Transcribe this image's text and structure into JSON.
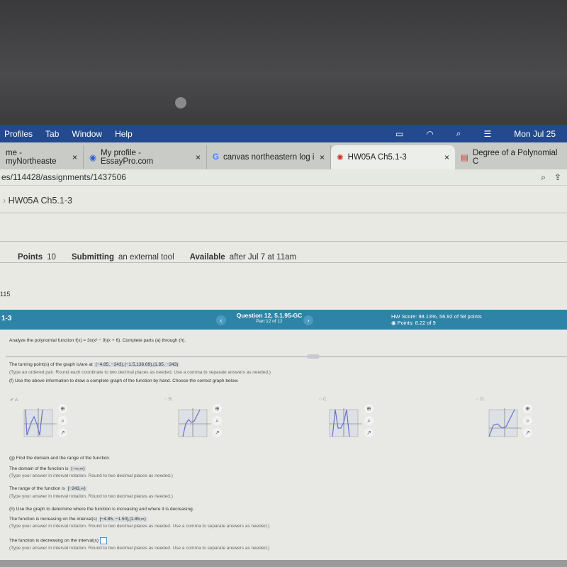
{
  "menubar": {
    "items": [
      "Profiles",
      "Tab",
      "Window",
      "Help"
    ],
    "clock": "Mon Jul 25"
  },
  "tabs": [
    {
      "label": "me - myNortheaste",
      "close": "×"
    },
    {
      "label": "My profile - EssayPro.com",
      "close": "×"
    },
    {
      "label": "canvas northeastern log i",
      "close": "×"
    },
    {
      "label": "HW05A Ch5.1-3",
      "close": "×",
      "active": true
    },
    {
      "label": "Degree of a Polynomial C"
    }
  ],
  "url": "es/114428/assignments/1437506",
  "page": {
    "breadcrumb": "HW05A Ch5.1-3",
    "points_label": "Points",
    "points": "10",
    "submitting_label": "Submitting",
    "submitting": "an external tool",
    "available_label": "Available",
    "available": "after Jul 7 at 11am",
    "small": "115"
  },
  "question_bar": {
    "left": "1-3",
    "title": "Question 12, 5.1.95-GC",
    "part": "Part 12 of 12",
    "hw_score": "HW Score: 98.13%, 56.92 of 58 points",
    "points": "Points: 8.22 of 9",
    "accent": "#2e84a6"
  },
  "content": {
    "prompt": "Analyze the polynomial function f(x) = 3x(x² − 9)(x + 6). Complete parts (a) through (h).",
    "turning_prefix": "The turning point(s) of the graph is/are at",
    "turning_answer": "(−4.85, −243),(−1.5,136.69),(1.85, −243)",
    "turning_hint": "(Type an ordered pair. Round each coordinate to two decimal places as needed. Use a comma to separate answers as needed.)",
    "f_prompt": "(f) Use the above information to draw a complete graph of the function by hand. Choose the correct graph below.",
    "options": [
      {
        "label": "A.",
        "selected": true,
        "ymax": "250",
        "ymin": "-250",
        "xmin": "-10",
        "xmax": "10"
      },
      {
        "label": "B.",
        "selected": false,
        "ymax": "250",
        "ymin": "-250",
        "xmin": "-10",
        "xmax": "10"
      },
      {
        "label": "C.",
        "selected": false,
        "ymax": "250",
        "ymin": "-250",
        "xmin": "-10",
        "xmax": "10"
      },
      {
        "label": "D.",
        "selected": false,
        "ymax": "250",
        "ymin": "-250",
        "xmin": "-10",
        "xmax": "10"
      }
    ],
    "g_prompt": "(g) Find the domain and the range of the function.",
    "domain_prefix": "The domain of the function is",
    "domain_answer": "(−∞,∞)",
    "domain_hint": "(Type your answer in interval notation. Round to two decimal places as needed.)",
    "range_prefix": "The range of the function is",
    "range_answer": "[−243,∞)",
    "range_hint": "(Type your answer in interval notation. Round to two decimal places as needed.)",
    "h_prompt": "(h) Use the graph to determine where the function is increasing and where it is decreasing.",
    "inc_prefix": "The function is increasing on the interval(s)",
    "inc_answer": "[−4.85, −1.50],[1.85,∞)",
    "inc_hint": "(Type your answer in interval notation. Round to two decimal places as needed. Use a comma to separate answers as needed.)",
    "dec_prefix": "The function is decreasing on the interval(s)",
    "dec_answer": "",
    "dec_hint": "(Type your answer in interval notation. Round to two decimal places as needed. Use a comma to separate answers as needed.)"
  }
}
